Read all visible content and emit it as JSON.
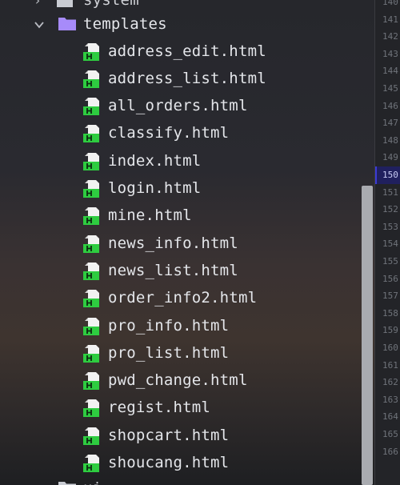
{
  "project_tree": {
    "partial_top_label": "system",
    "folder": {
      "name": "templates",
      "expanded": true,
      "icon": "folder-icon",
      "color": "#a78bfa"
    },
    "files": [
      "address_edit.html",
      "address_list.html",
      "all_orders.html",
      "classify.html",
      "index.html",
      "login.html",
      "mine.html",
      "news_info.html",
      "news_list.html",
      "order_info2.html",
      "pro_info.html",
      "pro_list.html",
      "pwd_change.html",
      "regist.html",
      "shopcart.html",
      "shoucang.html"
    ],
    "partial_bottom_label": "ui",
    "file_icon": "html-file-icon",
    "file_icon_color": "#2ecc40"
  },
  "gutter": {
    "line_numbers": [
      "140",
      "141",
      "142",
      "143",
      "144",
      "145",
      "146",
      "147",
      "148",
      "149",
      "150",
      "151",
      "152",
      "153",
      "154",
      "155",
      "156",
      "157",
      "158",
      "159",
      "160",
      "161",
      "162",
      "163",
      "164",
      "165",
      "166"
    ],
    "active_line": "150",
    "active_color": "#20205e"
  }
}
